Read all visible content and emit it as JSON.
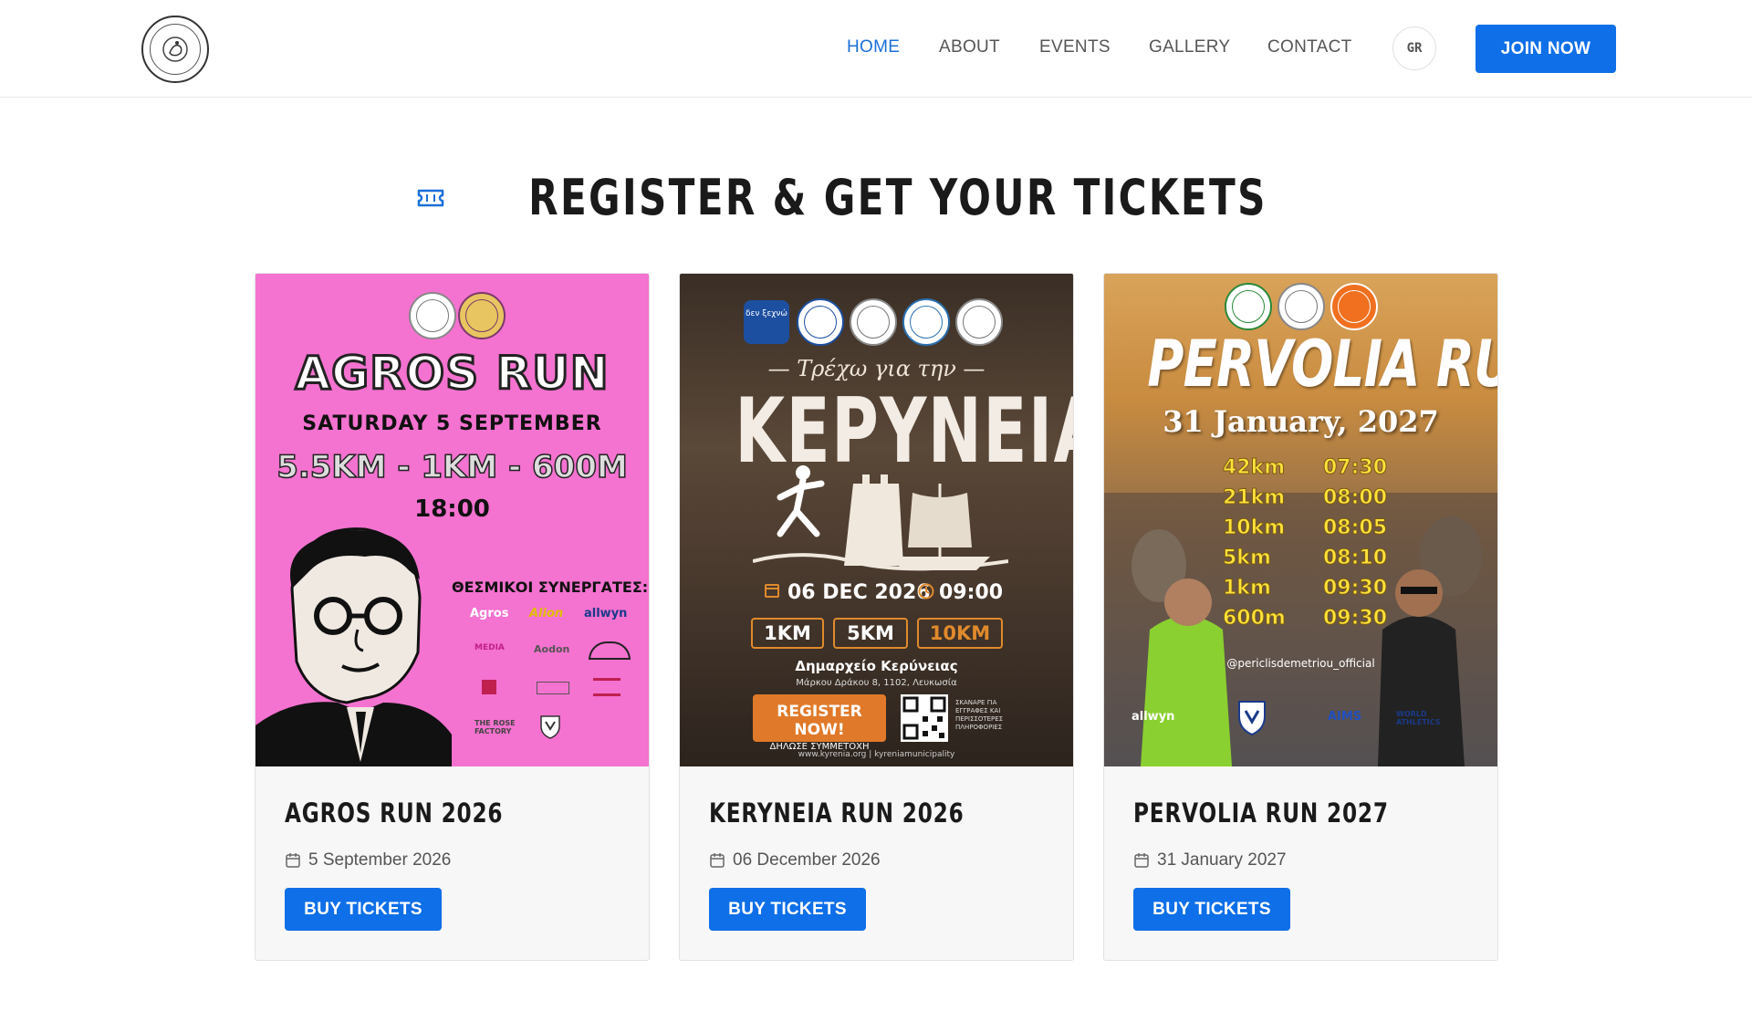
{
  "header": {
    "nav": [
      {
        "label": "HOME",
        "active": true
      },
      {
        "label": "ABOUT",
        "active": false
      },
      {
        "label": "EVENTS",
        "active": false
      },
      {
        "label": "GALLERY",
        "active": false
      },
      {
        "label": "CONTACT",
        "active": false
      }
    ],
    "lang_label": "GR",
    "join_label": "JOIN NOW"
  },
  "section": {
    "title": "REGISTER & GET YOUR TICKETS",
    "icon": "ticket-icon"
  },
  "colors": {
    "accent": "#0f6fe8",
    "nav_active": "#1a6fd8",
    "agros_bg": "#f472d0"
  },
  "cards": [
    {
      "title": "AGROS RUN 2026",
      "date": "5 September 2026",
      "button": "BUY TICKETS",
      "poster": {
        "headline": "AGROS RUN",
        "date_line": "SATURDAY 5 SEPTEMBER",
        "distances": "5.5KM - 1KM - 600M",
        "time": "18:00",
        "partners": "ΘΕΣΜΙΚΟΙ ΣΥΝΕΡΓΑΤΕΣ:",
        "sponsors": [
          "Agros",
          "Alion",
          "allwyn",
          "MEDIA",
          "Aodon",
          "THE ROSE FACTORY"
        ]
      }
    },
    {
      "title": "KERYNEIA RUN 2026",
      "date": "06 December 2026",
      "button": "BUY TICKETS",
      "poster": {
        "subtitle": "— Τρέχω για την —",
        "headline": "ΚΕΡΥΝΕΙΑ",
        "date_line": "06 DEC 2026",
        "time": "09:00",
        "distances": [
          "1KM",
          "5KM",
          "10KM"
        ],
        "place": "Δημαρχείο Κερύνειας",
        "address": "Μάρκου Δράκου 8, 1102, Λευκωσία",
        "register": "REGISTER NOW!",
        "register_sub": "ΔΗΛΩΣΕ ΣΥΜΜΕΤΟΧΗ",
        "scan": "ΣΚΑΝΑΡΕ ΓΙΑ ΕΓΓΡΑΦΕΣ ΚΑΙ ΠΕΡΙΣΣΟΤΕΡΕΣ ΠΛΗΡΟΦΟΡΙΕΣ",
        "footer": "www.kyrenia.org  |  kyreniamunicipality",
        "badge_text": "δεν ξεχνώ"
      }
    },
    {
      "title": "PERVOLIA RUN 2027",
      "date": "31 January 2027",
      "button": "BUY TICKETS",
      "poster": {
        "headline": "PERVOLIA RUN",
        "date_line": "31 January, 2027",
        "schedule": [
          {
            "dist": "42km",
            "time": "07:30"
          },
          {
            "dist": "21km",
            "time": "08:00"
          },
          {
            "dist": "10km",
            "time": "08:05"
          },
          {
            "dist": "5km",
            "time": "08:10"
          },
          {
            "dist": "1km",
            "time": "09:30"
          },
          {
            "dist": "600m",
            "time": "09:30"
          }
        ],
        "handle": "@periclisdemetriou_official",
        "sponsors": [
          "allwyn",
          "AIMS",
          "WORLD ATHLETICS"
        ]
      }
    }
  ]
}
